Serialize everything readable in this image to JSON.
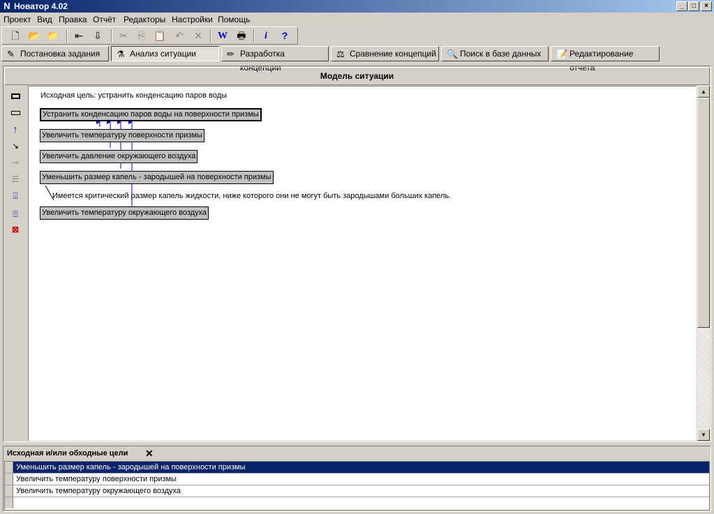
{
  "window": {
    "title": "Новатор 4.02"
  },
  "menu": [
    "Проект",
    "Вид",
    "Правка",
    "Отчёт",
    "Редакторы",
    "Настройки",
    "Помощь"
  ],
  "toolbar_icons": [
    "new-file-icon",
    "open-folder-icon",
    "save-icon",
    "import-icon",
    "export-icon",
    "cut-icon",
    "copy-icon",
    "paste-icon",
    "undo-icon",
    "delete-icon",
    "word-icon",
    "print-icon",
    "info-icon",
    "help-icon"
  ],
  "tabs": [
    {
      "label": "Постановка задания",
      "icon": "task-icon"
    },
    {
      "label": "Анализ ситуации",
      "icon": "analysis-icon",
      "active": true
    },
    {
      "label": "Разработка концепции",
      "icon": "pencil-icon"
    },
    {
      "label": "Сравнение концепций",
      "icon": "scales-icon"
    },
    {
      "label": "Поиск в базе данных",
      "icon": "database-search-icon"
    },
    {
      "label": "Редактирование отчета",
      "icon": "report-edit-icon"
    }
  ],
  "model": {
    "header": "Модель ситуации",
    "initial_goal": "Исходная цель: устранить конденсацию паров воды",
    "main_node": "Устранить конденсацию паров воды на поверхности призмы",
    "nodes": [
      "Увеличить температуру поверхности призмы",
      "Увеличить давление окружающего воздуха",
      "Уменьшить размер капель - зародышей на поверхности призмы",
      "Увеличить температуру окружающего воздуха"
    ],
    "comment": "Имеется критический размер капель жидкости, ниже которого они не могут быть зародышами больших капель."
  },
  "side_tools": [
    "rectangle-tool-icon",
    "flat-rectangle-icon",
    "arrow-up-icon",
    "comment-link-icon",
    "link-icon",
    "list-icon",
    "arrow-down-box-icon",
    "arrow-up-box-icon",
    "delete-box-icon"
  ],
  "bottom": {
    "header": "Исходная и/или обходные цели",
    "rows": [
      "Уменьшить размер капель - зародышей на поверхности призмы",
      "Увеличить температуру поверхности призмы",
      "Увеличить температуру окружающего воздуха"
    ],
    "selected_row": 0
  },
  "colors": {
    "title_start": "#0a246a",
    "title_end": "#a6caf0",
    "selection": "#0a246a",
    "arrow": "#0000cc"
  }
}
